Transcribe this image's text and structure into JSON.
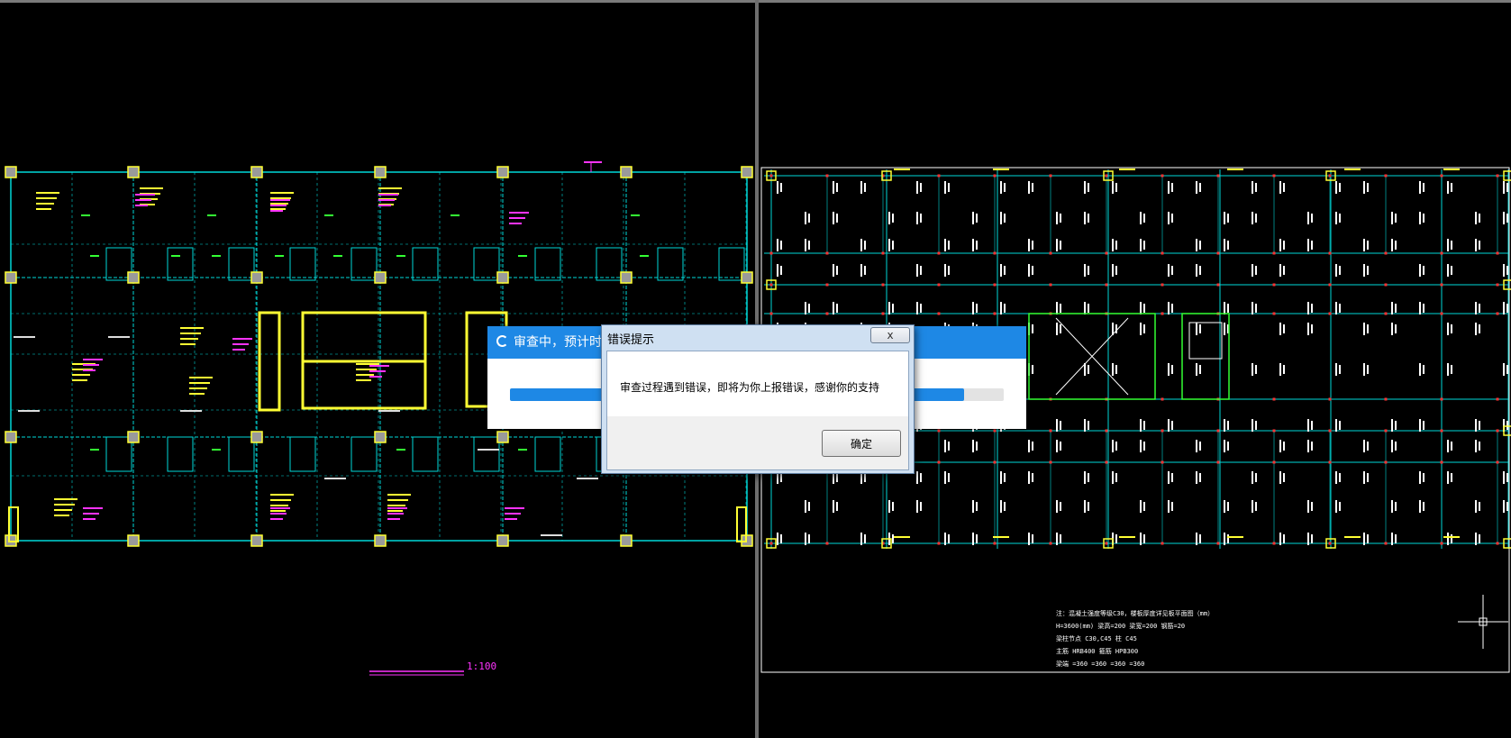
{
  "window": {
    "left_pane": "cad-floor-plan",
    "right_pane": "cad-reinforcement-plan"
  },
  "left_drawing": {
    "scale_label": "1:100"
  },
  "right_drawing": {
    "notes": [
      "注：混凝土强度等级C30，楼板厚度详见板平面图（mm）",
      "H=3600(mm) 梁高=200 梁宽=200 钢筋=20",
      "梁柱节点 C30,C45 柱 C45",
      "主筋 HRB400 箍筋 HPB300",
      "梁端 =360 =360 =360 =360"
    ]
  },
  "progress_dialog": {
    "title": "审查中，预计时间",
    "progress_percent": 92
  },
  "error_dialog": {
    "title": "错误提示",
    "close_label": "x",
    "message": "审查过程遇到错误，即将为你上报错误，感谢你的支持",
    "ok_label": "确定"
  },
  "colors": {
    "dialog_blue": "#1e88e5",
    "cad_cyan": "#00d8d8",
    "cad_yellow": "#ffff33",
    "cad_magenta": "#ff33ff"
  }
}
